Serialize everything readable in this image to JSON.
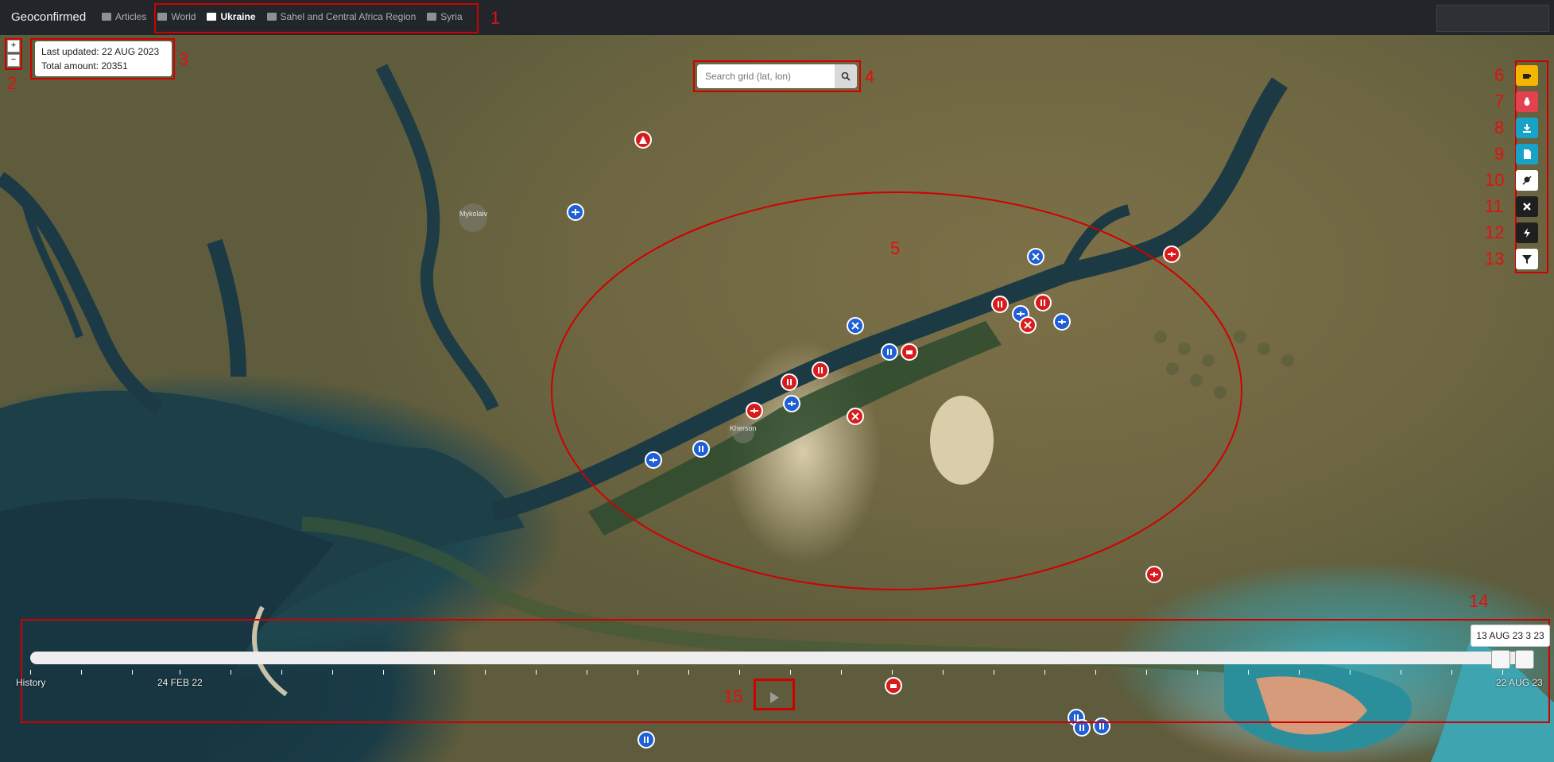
{
  "app": {
    "brand": "Geoconfirmed"
  },
  "nav": [
    {
      "label": "Articles",
      "icon": "newspaper-icon",
      "active": false
    },
    {
      "label": "World",
      "icon": "map-icon",
      "active": false
    },
    {
      "label": "Ukraine",
      "icon": "map-icon",
      "active": true
    },
    {
      "label": "Sahel and Central Africa Region",
      "icon": "map-icon",
      "active": false
    },
    {
      "label": "Syria",
      "icon": "map-icon",
      "active": false
    }
  ],
  "zoom": {
    "in_label": "+",
    "out_label": "−"
  },
  "info": {
    "last_updated": "Last updated: 22 AUG 2023",
    "total_amount": "Total amount: 20351"
  },
  "search": {
    "placeholder": "Search grid (lat, lon)"
  },
  "toolbar": [
    {
      "name": "coffee-icon",
      "color": "#f5b400"
    },
    {
      "name": "bug-icon",
      "color": "#e2424e"
    },
    {
      "name": "download-icon",
      "color": "#17a2c8"
    },
    {
      "name": "file-icon",
      "color": "#17a2c8"
    },
    {
      "name": "location-off-icon",
      "color": "#ffffff"
    },
    {
      "name": "close-icon",
      "color": "#1f1f1f"
    },
    {
      "name": "bolt-icon",
      "color": "#1f1f1f"
    },
    {
      "name": "filter-icon",
      "color": "#ffffff"
    }
  ],
  "map_labels": {
    "city_1": "Mykolaiv",
    "city_2": "Kherson"
  },
  "timeline": {
    "tooltip": "13 AUG 23 3 23",
    "labels": [
      "History",
      "24 FEB 22",
      "22 AUG 23"
    ]
  },
  "annotations": [
    "1",
    "2",
    "3",
    "4",
    "5",
    "6",
    "7",
    "8",
    "9",
    "10",
    "11",
    "12",
    "13",
    "14",
    "15"
  ],
  "colors": {
    "accent_red": "#e11010",
    "marker_red": "#d81c1c",
    "marker_blue": "#1f5fd6"
  }
}
